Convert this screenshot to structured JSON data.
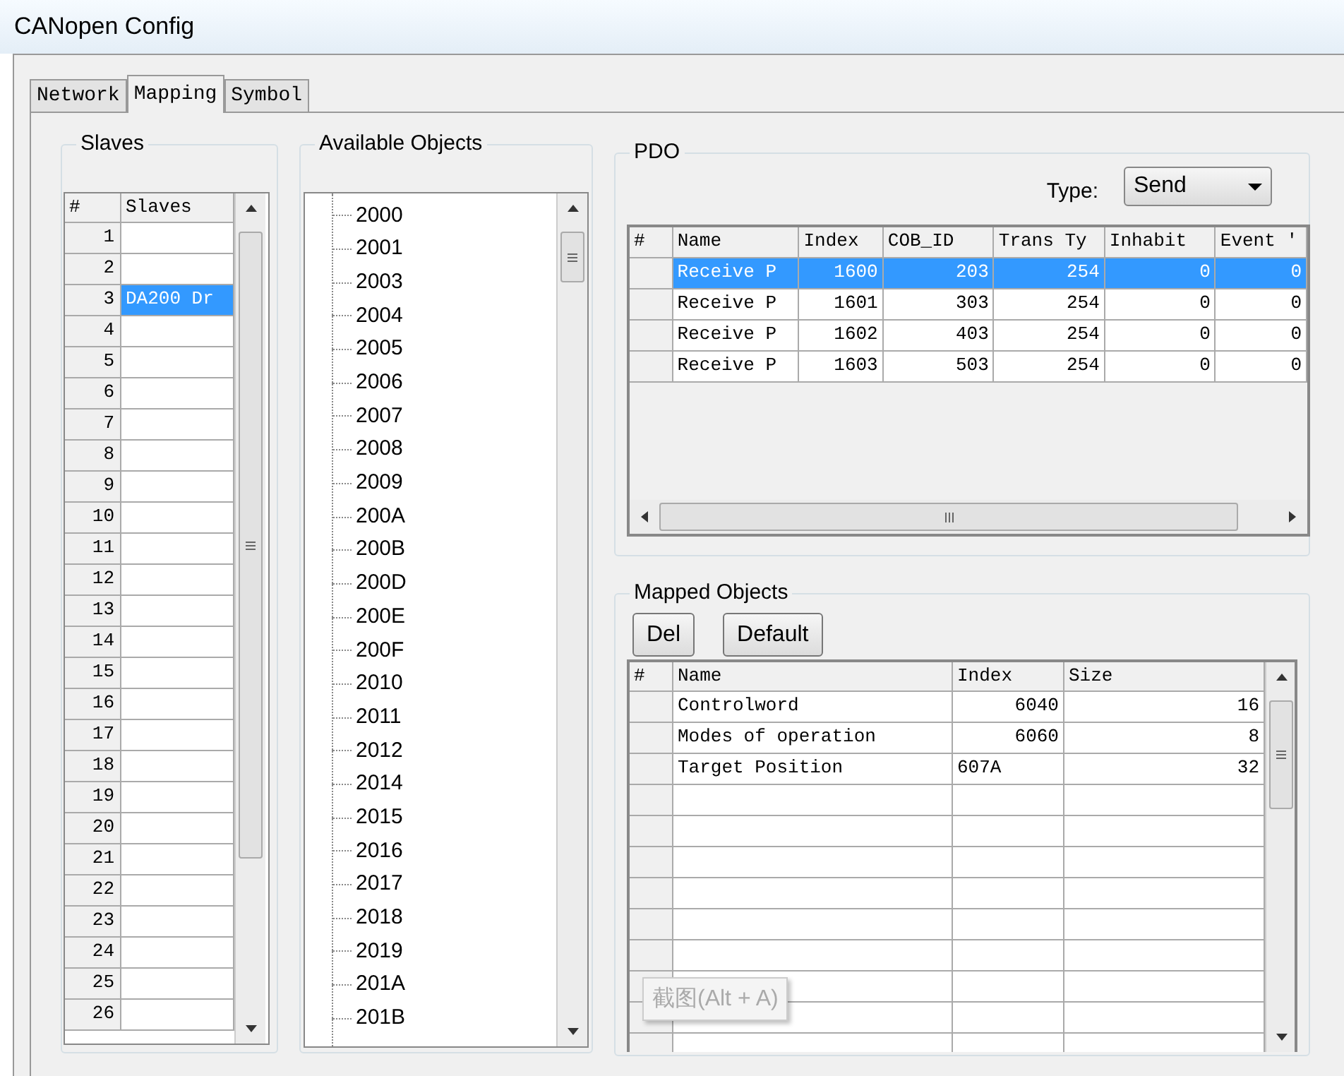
{
  "window": {
    "title": "CANopen Config"
  },
  "tabs": [
    {
      "label": "Network",
      "selected": false
    },
    {
      "label": "Mapping",
      "selected": true
    },
    {
      "label": "Symbol",
      "selected": false
    }
  ],
  "slaves": {
    "title": "Slaves",
    "columns": [
      "#",
      "Slaves"
    ],
    "rows": [
      {
        "number": "1",
        "name": "",
        "selected": false
      },
      {
        "number": "2",
        "name": "",
        "selected": false
      },
      {
        "number": "3",
        "name": "DA200 Dr",
        "selected": true
      },
      {
        "number": "4",
        "name": "",
        "selected": false
      },
      {
        "number": "5",
        "name": "",
        "selected": false
      },
      {
        "number": "6",
        "name": "",
        "selected": false
      },
      {
        "number": "7",
        "name": "",
        "selected": false
      },
      {
        "number": "8",
        "name": "",
        "selected": false
      },
      {
        "number": "9",
        "name": "",
        "selected": false
      },
      {
        "number": "10",
        "name": "",
        "selected": false
      },
      {
        "number": "11",
        "name": "",
        "selected": false
      },
      {
        "number": "12",
        "name": "",
        "selected": false
      },
      {
        "number": "13",
        "name": "",
        "selected": false
      },
      {
        "number": "14",
        "name": "",
        "selected": false
      },
      {
        "number": "15",
        "name": "",
        "selected": false
      },
      {
        "number": "16",
        "name": "",
        "selected": false
      },
      {
        "number": "17",
        "name": "",
        "selected": false
      },
      {
        "number": "18",
        "name": "",
        "selected": false
      },
      {
        "number": "19",
        "name": "",
        "selected": false
      },
      {
        "number": "20",
        "name": "",
        "selected": false
      },
      {
        "number": "21",
        "name": "",
        "selected": false
      },
      {
        "number": "22",
        "name": "",
        "selected": false
      },
      {
        "number": "23",
        "name": "",
        "selected": false
      },
      {
        "number": "24",
        "name": "",
        "selected": false
      },
      {
        "number": "25",
        "name": "",
        "selected": false
      },
      {
        "number": "26",
        "name": "",
        "selected": false
      }
    ]
  },
  "available_objects": {
    "title": "Available Objects",
    "items": [
      "2000",
      "2001",
      "2003",
      "2004",
      "2005",
      "2006",
      "2007",
      "2008",
      "2009",
      "200A",
      "200B",
      "200D",
      "200E",
      "200F",
      "2010",
      "2011",
      "2012",
      "2014",
      "2015",
      "2016",
      "2017",
      "2018",
      "2019",
      "201A",
      "201B"
    ]
  },
  "pdo": {
    "title": "PDO",
    "type_label": "Type:",
    "type_value": "Send",
    "columns": [
      "#",
      "Name",
      "Index",
      "COB_ID",
      "Trans Ty",
      "Inhabit",
      "Event '"
    ],
    "rows": [
      {
        "cells": [
          "",
          "Receive P",
          "1600",
          "203",
          "254",
          "0",
          "0"
        ],
        "selected": true
      },
      {
        "cells": [
          "",
          "Receive P",
          "1601",
          "303",
          "254",
          "0",
          "0"
        ],
        "selected": false
      },
      {
        "cells": [
          "",
          "Receive P",
          "1602",
          "403",
          "254",
          "0",
          "0"
        ],
        "selected": false
      },
      {
        "cells": [
          "",
          "Receive P",
          "1603",
          "503",
          "254",
          "0",
          "0"
        ],
        "selected": false
      }
    ]
  },
  "mapped_objects": {
    "title": "Mapped Objects",
    "buttons": [
      "Del",
      "Default"
    ],
    "columns": [
      "#",
      "Name",
      "Index",
      "Size"
    ],
    "rows": [
      {
        "name": "Controlword",
        "index": "6040",
        "size": "16"
      },
      {
        "name": "Modes of operation",
        "index": "6060",
        "size": "8"
      },
      {
        "name": "Target Position",
        "index": "607A",
        "size": "32"
      }
    ]
  },
  "tooltip": "截图(Alt + A)"
}
